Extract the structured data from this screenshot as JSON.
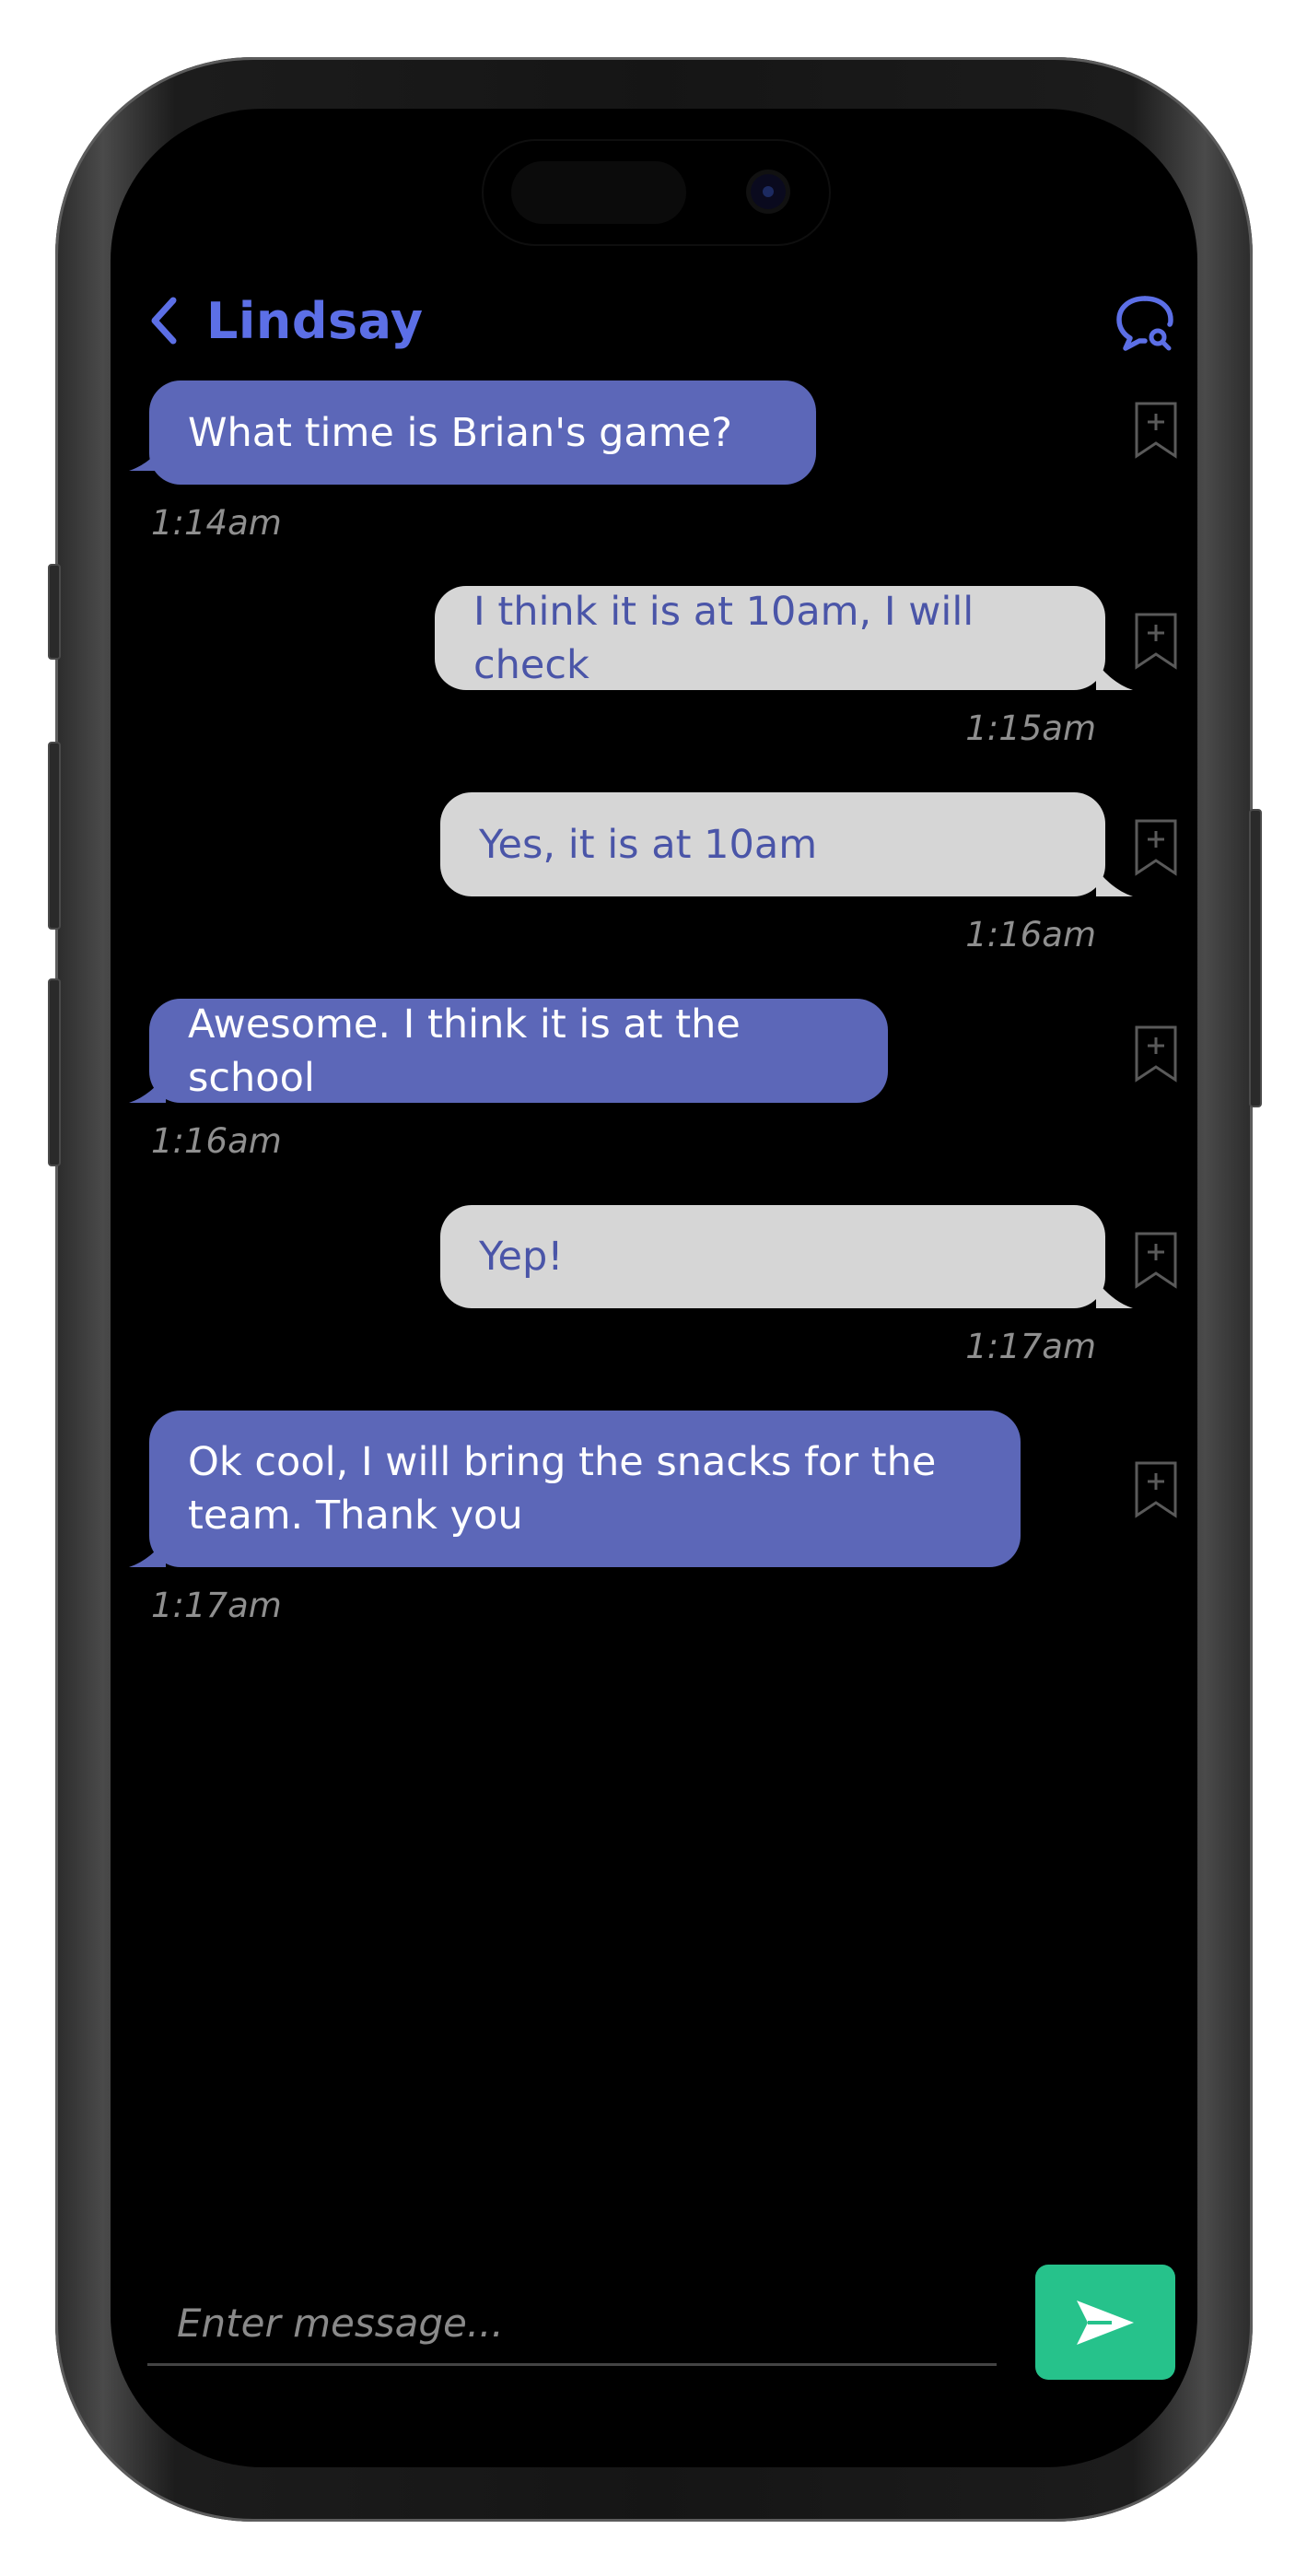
{
  "header": {
    "contact_name": "Lindsay"
  },
  "colors": {
    "accent": "#5c6fe6",
    "incoming_bubble": "#5c67b8",
    "outgoing_bubble": "#d6d6d6",
    "outgoing_text": "#4a55a8",
    "send_button": "#26c28b"
  },
  "messages": [
    {
      "direction": "incoming",
      "text": "What time is Brian's game?",
      "time": "1:14am"
    },
    {
      "direction": "outgoing",
      "text": "I think it is at 10am, I will check",
      "time": "1:15am"
    },
    {
      "direction": "outgoing",
      "text": "Yes, it is at 10am",
      "time": "1:16am"
    },
    {
      "direction": "incoming",
      "text": "Awesome. I think it is at the school",
      "time": "1:16am"
    },
    {
      "direction": "outgoing",
      "text": "Yep!",
      "time": "1:17am"
    },
    {
      "direction": "incoming",
      "text": "Ok cool, I will bring the snacks for the team. Thank you",
      "time": "1:17am"
    }
  ],
  "composer": {
    "placeholder": "Enter message...",
    "value": ""
  },
  "icons": {
    "back": "chevron-left-icon",
    "search_chat": "chat-search-icon",
    "bookmark": "bookmark-add-icon",
    "send": "send-icon"
  }
}
